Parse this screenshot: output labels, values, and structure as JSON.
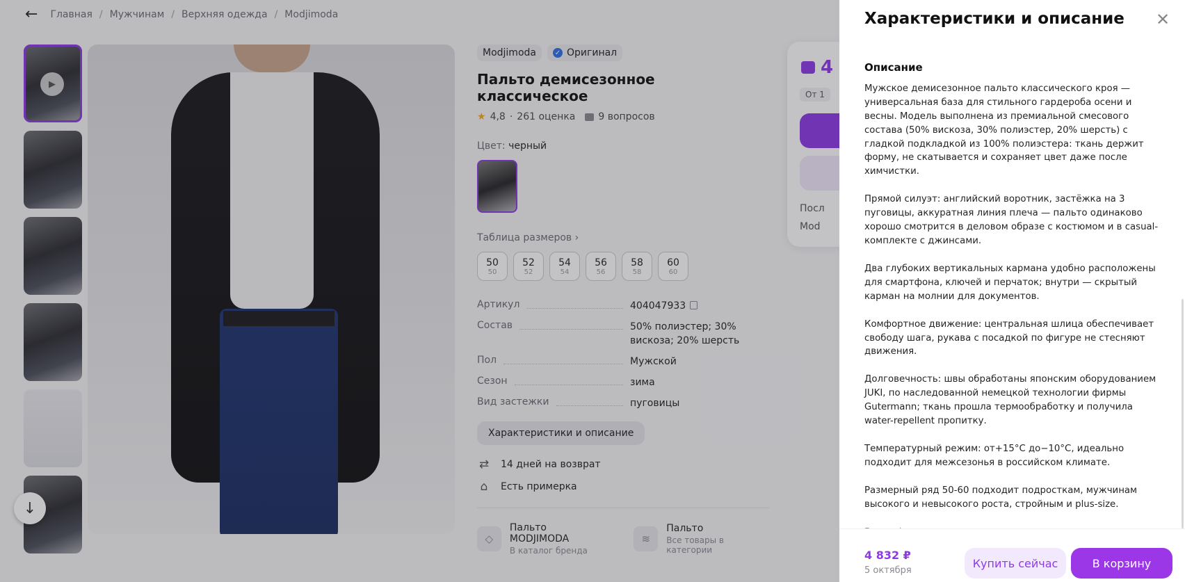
{
  "breadcrumbs": [
    "Главная",
    "Мужчинам",
    "Верхняя одежда",
    "Modjimoda"
  ],
  "product": {
    "brand": "Modjimoda",
    "original_label": "Оригинал",
    "title": "Пальто демисезонное классическое",
    "rating": "4,8",
    "reviews": "261 оценка",
    "questions": "9 вопросов",
    "color_label": "Цвет:",
    "color_value": "черный",
    "size_table_label": "Таблица размеров",
    "sizes": [
      {
        "n": "50",
        "s": "50"
      },
      {
        "n": "52",
        "s": "52"
      },
      {
        "n": "54",
        "s": "54"
      },
      {
        "n": "56",
        "s": "56"
      },
      {
        "n": "58",
        "s": "58"
      },
      {
        "n": "60",
        "s": "60"
      }
    ],
    "specs": [
      {
        "k": "Артикул",
        "v": "404047933"
      },
      {
        "k": "Состав",
        "v": "50% полиэстер; 30% вискоза; 20% шерсть"
      },
      {
        "k": "Пол",
        "v": "Мужской"
      },
      {
        "k": "Сезон",
        "v": "зима"
      },
      {
        "k": "Вид застежки",
        "v": "пуговицы"
      }
    ],
    "char_button": "Характеристики и описание",
    "return_label": "14 дней на возврат",
    "fitting_label": "Есть примерка",
    "brand_link": {
      "title": "Пальто MODJIMODA",
      "sub": "В каталог бренда"
    },
    "category_link": {
      "title": "Пальто",
      "sub": "Все товары в категории"
    }
  },
  "price_card": {
    "price_partial": "4",
    "from_partial": "От 1",
    "line1_partial": "Посл",
    "line2_partial": "Mod"
  },
  "drawer": {
    "title": "Характеристики и описание",
    "section_title": "Описание",
    "paragraphs": [
      "Мужское демисезонное пальто классического кроя — универсальная база для стильного гардероба осени и весны. Модель выполнена из премиальной смесового состава (50% вискоза, 30% полиэстер, 20% шерсть) с гладкой подкладкой из 100% полиэстера: ткань держит форму, не скатывается и сохраняет цвет даже после химчистки.",
      "Прямой силуэт: английский воротник, застёжка на 3 пуговицы, аккуратная линия плеча — пальто одинаково хорошо смотрится в деловом образе с костюмом и в casual-комплекте с джинсами.",
      "Два глубоких вертикальных кармана удобно расположены для смартфона, ключей и перчаток; внутри — скрытый карман на молнии для документов.",
      "Комфортное движение: центральная шлица обеспечивает свободу шага, рукава с посадкой по фигуре не стесняют движения.",
      "Долговечность: швы обработаны японским оборудованием JUKI, по наследованной немецкой технологии фирмы Gutermann; ткань прошла термообработку и получила water-repellent пропитку.",
      "Температурный режим: от+15°С до−10°С, идеально подходит для межсезонья в российском климате.",
      "Размерный ряд 50-60 подходит подросткам, мужчинам высокого и невысокого роста, стройным и plus-size."
    ],
    "note": "Вся информация предоставлена продавцом",
    "footer": {
      "price": "4 832 ₽",
      "date": "5 октября",
      "buy_now": "Купить сейчас",
      "add_to_cart": "В корзину"
    }
  },
  "colors": {
    "accent": "#8e3ae6",
    "overlay": "rgba(40,40,48,0.28)"
  }
}
